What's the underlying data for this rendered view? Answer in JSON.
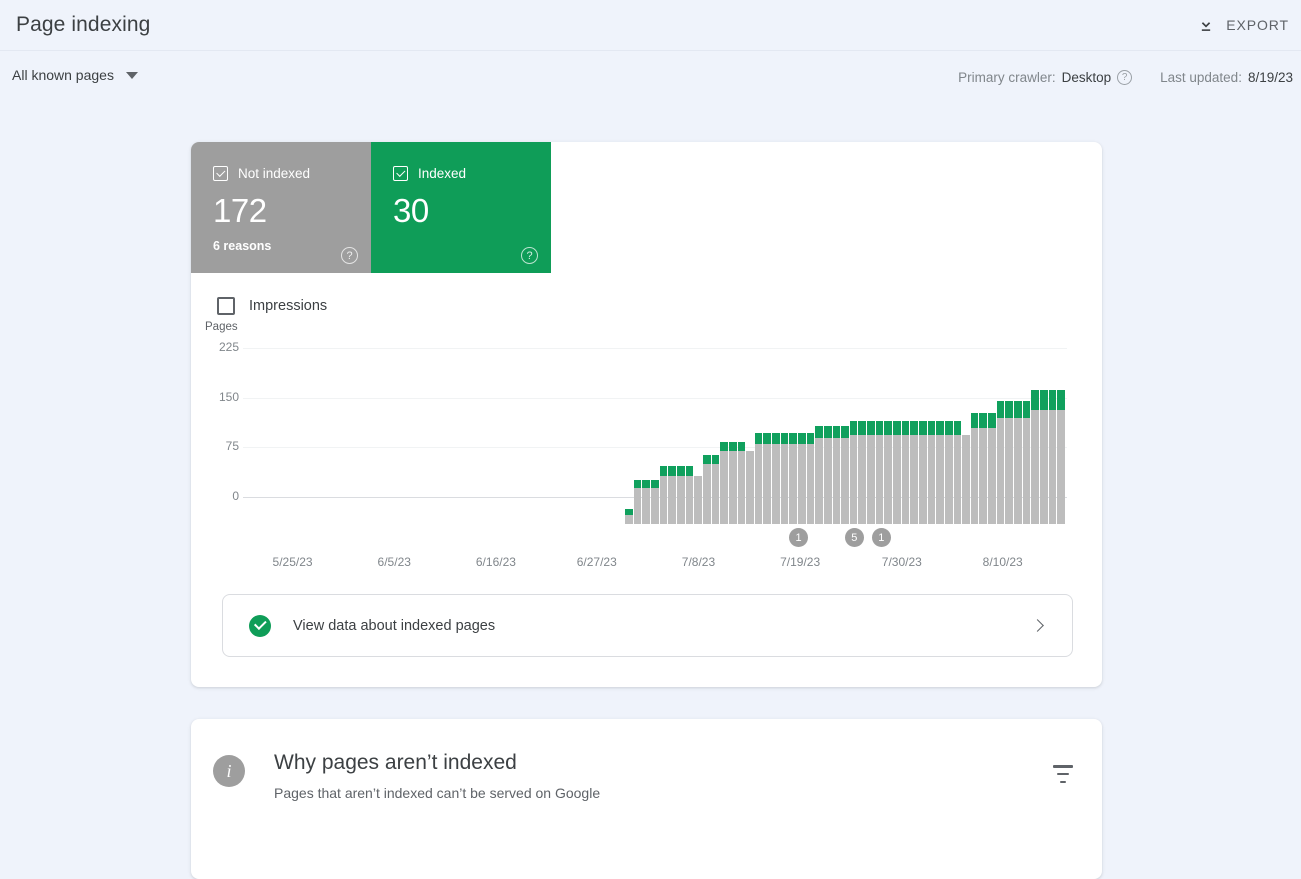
{
  "header": {
    "title": "Page indexing",
    "export_label": "EXPORT",
    "export_icon": "download-icon"
  },
  "filters": {
    "scope_label": "All known pages",
    "scope_icon": "chevron-down-icon",
    "primary_crawler_label": "Primary crawler:",
    "primary_crawler_value": "Desktop",
    "crawler_help_icon": "help-icon",
    "last_updated_label": "Last updated:",
    "last_updated_value": "8/19/23"
  },
  "cards": [
    {
      "name": "not-indexed",
      "label": "Not indexed",
      "value": "172",
      "sub": "6 reasons",
      "color": "#9e9e9e",
      "checked": true,
      "help_icon": "help-icon"
    },
    {
      "name": "indexed",
      "label": "Indexed",
      "value": "30",
      "sub": "",
      "color": "#0f9d58",
      "checked": true,
      "help_icon": "help-icon"
    }
  ],
  "impressions": {
    "label": "Impressions",
    "checked": false
  },
  "view_data_row": {
    "label": "View data about indexed pages",
    "status_icon": "check-circle-icon",
    "chevron_icon": "chevron-right-icon"
  },
  "why_panel": {
    "icon": "info-icon",
    "title": "Why pages aren’t indexed",
    "subtitle": "Pages that aren’t indexed can’t be served on Google",
    "filter_icon": "filter-icon"
  },
  "chart_data": {
    "type": "bar",
    "stacked": true,
    "title": "",
    "ylabel": "Pages",
    "xlabel": "",
    "ylim": [
      0,
      225
    ],
    "yticks": [
      225,
      150,
      75,
      0
    ],
    "grid": true,
    "legend_position": "cards-above",
    "xtick_labels": [
      "5/25/23",
      "6/5/23",
      "6/16/23",
      "6/27/23",
      "7/8/23",
      "7/19/23",
      "7/30/23",
      "8/10/23"
    ],
    "xtick_positions_pct": [
      5.8,
      18.2,
      30.6,
      42.9,
      55.3,
      67.7,
      80.1,
      92.4
    ],
    "series": [
      {
        "name": "Not indexed",
        "color": "#bdbdbd",
        "values": [
          0,
          0,
          0,
          0,
          0,
          0,
          0,
          0,
          0,
          0,
          0,
          0,
          0,
          0,
          0,
          0,
          0,
          0,
          0,
          0,
          0,
          0,
          0,
          0,
          0,
          0,
          0,
          0,
          0,
          0,
          0,
          0,
          0,
          0,
          0,
          0,
          0,
          0,
          0,
          0,
          0,
          0,
          0,
          0,
          14,
          55,
          55,
          55,
          73,
          73,
          73,
          73,
          73,
          90,
          90,
          110,
          110,
          110,
          110,
          121,
          121,
          121,
          121,
          121,
          121,
          121,
          130,
          130,
          130,
          130,
          135,
          135,
          135,
          135,
          135,
          135,
          135,
          135,
          135,
          135,
          135,
          135,
          135,
          135,
          145,
          145,
          145,
          160,
          160,
          160,
          160,
          172,
          172,
          172,
          172
        ]
      },
      {
        "name": "Indexed",
        "color": "#10a05d",
        "values": [
          0,
          0,
          0,
          0,
          0,
          0,
          0,
          0,
          0,
          0,
          0,
          0,
          0,
          0,
          0,
          0,
          0,
          0,
          0,
          0,
          0,
          0,
          0,
          0,
          0,
          0,
          0,
          0,
          0,
          0,
          0,
          0,
          0,
          0,
          0,
          0,
          0,
          0,
          0,
          0,
          0,
          0,
          0,
          0,
          8,
          12,
          12,
          12,
          14,
          14,
          14,
          14,
          0,
          14,
          14,
          14,
          14,
          14,
          0,
          16,
          16,
          16,
          16,
          16,
          16,
          16,
          18,
          18,
          18,
          18,
          20,
          20,
          20,
          20,
          20,
          20,
          20,
          20,
          20,
          20,
          20,
          20,
          20,
          0,
          22,
          22,
          22,
          26,
          26,
          26,
          26,
          30,
          30,
          30,
          30
        ]
      }
    ],
    "annotations": [
      {
        "label": "1",
        "x_pct": 67.5
      },
      {
        "label": "5",
        "x_pct": 74.3
      },
      {
        "label": "1",
        "x_pct": 77.6
      }
    ]
  }
}
